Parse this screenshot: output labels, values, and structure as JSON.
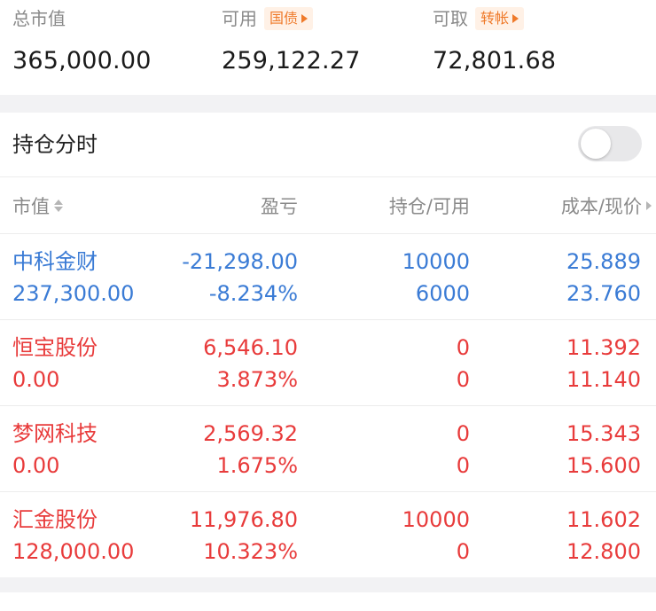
{
  "summary": {
    "total_value_label": "总市值",
    "total_value": "365,000.00",
    "available_label": "可用",
    "available_tag": "国债",
    "available_value": "259,122.27",
    "withdrawable_label": "可取",
    "withdrawable_tag": "转帐",
    "withdrawable_value": "72,801.68"
  },
  "panel": {
    "title": "持仓分时",
    "toggle_on": false
  },
  "columns": {
    "market_value": "市值",
    "profit_loss": "盈亏",
    "position": "持仓/可用",
    "cost_price": "成本/现价"
  },
  "holdings": [
    {
      "name": "中科金财",
      "market_value": "237,300.00",
      "pl": "-21,298.00",
      "pl_pct": "-8.234%",
      "position": "10000",
      "available": "6000",
      "cost": "25.889",
      "price": "23.760",
      "color": "#3a7bd5"
    },
    {
      "name": "恒宝股份",
      "market_value": "0.00",
      "pl": "6,546.10",
      "pl_pct": "3.873%",
      "position": "0",
      "available": "0",
      "cost": "11.392",
      "price": "11.140",
      "color": "#e83b3b"
    },
    {
      "name": "梦网科技",
      "market_value": "0.00",
      "pl": "2,569.32",
      "pl_pct": "1.675%",
      "position": "0",
      "available": "0",
      "cost": "15.343",
      "price": "15.600",
      "color": "#e83b3b"
    },
    {
      "name": "汇金股份",
      "market_value": "128,000.00",
      "pl": "11,976.80",
      "pl_pct": "10.323%",
      "position": "10000",
      "available": "0",
      "cost": "11.602",
      "price": "12.800",
      "color": "#e83b3b"
    }
  ]
}
